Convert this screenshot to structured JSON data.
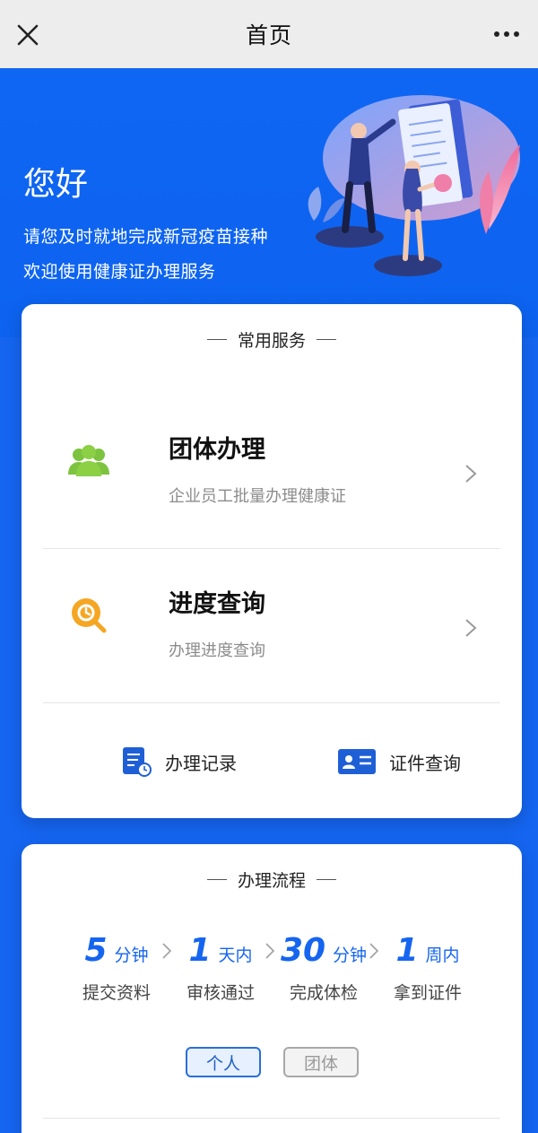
{
  "navbar": {
    "title": "首页",
    "close_icon": "close-icon",
    "more_icon": "more-icon"
  },
  "hero": {
    "greeting": "您好",
    "line1": "请您及时就地完成新冠疫苗接种",
    "line2": "欢迎使用健康证办理服务"
  },
  "services": {
    "title": "常用服务",
    "items": [
      {
        "title": "团体办理",
        "subtitle": "企业员工批量办理健康证",
        "icon": "group-icon"
      },
      {
        "title": "进度查询",
        "subtitle": "办理进度查询",
        "icon": "progress-search-icon"
      }
    ],
    "quick": [
      {
        "label": "办理记录",
        "icon": "records-icon"
      },
      {
        "label": "证件查询",
        "icon": "id-card-icon"
      }
    ]
  },
  "flow": {
    "title": "办理流程",
    "steps": [
      {
        "num": "5",
        "unit": "分钟",
        "label": "提交资料"
      },
      {
        "num": "1",
        "unit": "天内",
        "label": "审核通过"
      },
      {
        "num": "30",
        "unit": "分钟",
        "label": "完成体检"
      },
      {
        "num": "1",
        "unit": "周内",
        "label": "拿到证件"
      }
    ],
    "tabs": [
      {
        "label": "个人",
        "selected": true
      },
      {
        "label": "团体",
        "selected": false
      }
    ]
  },
  "colors": {
    "brand": "#1565f0",
    "green_icon": "#7dc33f",
    "orange_icon": "#f5a623"
  }
}
